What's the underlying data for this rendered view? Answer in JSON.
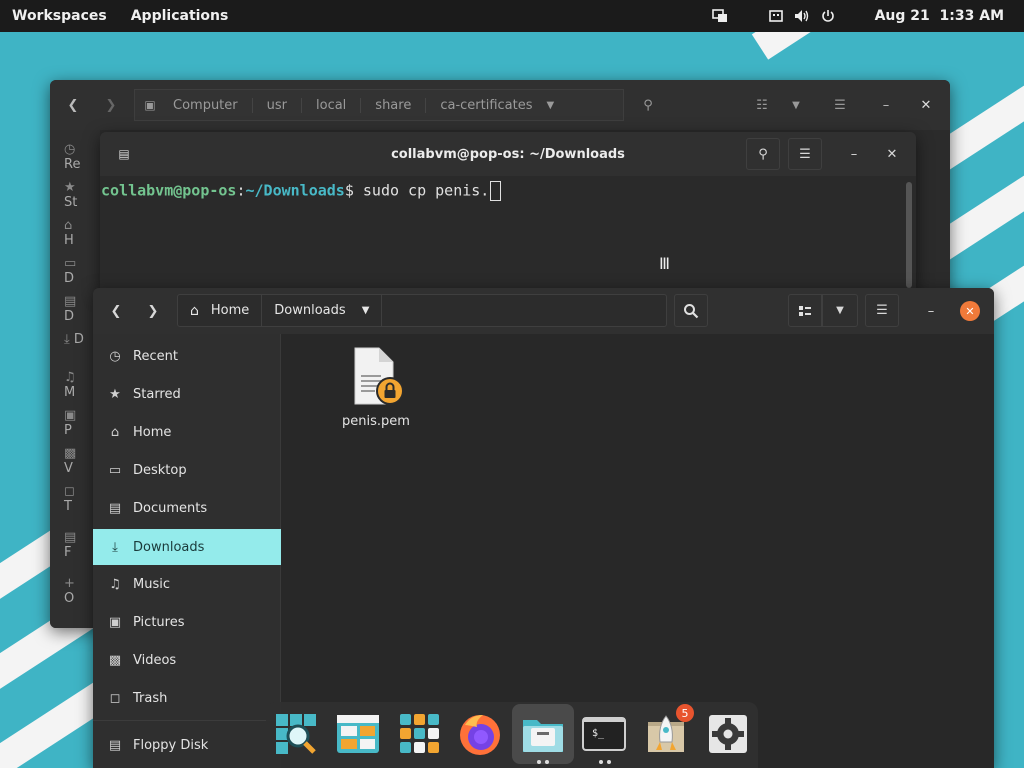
{
  "top_panel": {
    "workspaces": "Workspaces",
    "applications": "Applications",
    "date": "Aug 21",
    "time": "1:33 AM"
  },
  "bg_files": {
    "breadcrumbs": [
      "Computer",
      "usr",
      "local",
      "share",
      "ca-certificates"
    ],
    "sidebar_partial": [
      "Re",
      "St",
      "H",
      "D",
      "D",
      "D",
      "M",
      "P",
      "V",
      "T",
      "F",
      "O"
    ]
  },
  "terminal": {
    "title": "collabvm@pop-os: ~/Downloads",
    "prompt_user": "collabvm@pop-os",
    "prompt_colon": ":",
    "prompt_path": "~/Downloads",
    "prompt_symbol": "$ ",
    "command": "sudo cp penis."
  },
  "files": {
    "breadcrumbs": [
      "Home",
      "Downloads"
    ],
    "sidebar": [
      {
        "label": "Recent",
        "icon": "clock-icon"
      },
      {
        "label": "Starred",
        "icon": "star-icon"
      },
      {
        "label": "Home",
        "icon": "home-icon"
      },
      {
        "label": "Desktop",
        "icon": "desktop-icon"
      },
      {
        "label": "Documents",
        "icon": "document-icon"
      },
      {
        "label": "Downloads",
        "icon": "download-icon"
      },
      {
        "label": "Music",
        "icon": "music-icon"
      },
      {
        "label": "Pictures",
        "icon": "picture-icon"
      },
      {
        "label": "Videos",
        "icon": "video-icon"
      },
      {
        "label": "Trash",
        "icon": "trash-icon"
      },
      {
        "label": "Floppy Disk",
        "icon": "floppy-icon"
      }
    ],
    "active_item": "Downloads",
    "file_name": "penis.pem"
  },
  "dock": {
    "items": [
      "search-icon",
      "files-app-icon",
      "app-grid-icon",
      "firefox-icon",
      "nautilus-icon",
      "terminal-icon",
      "pop-shop-icon",
      "settings-icon"
    ],
    "badge_count": "5",
    "terminal_glyph": "$_"
  },
  "colors": {
    "accent": "#94ebeb",
    "wallpaper": "#3fb4c5",
    "close_orange": "#f07a3a"
  }
}
